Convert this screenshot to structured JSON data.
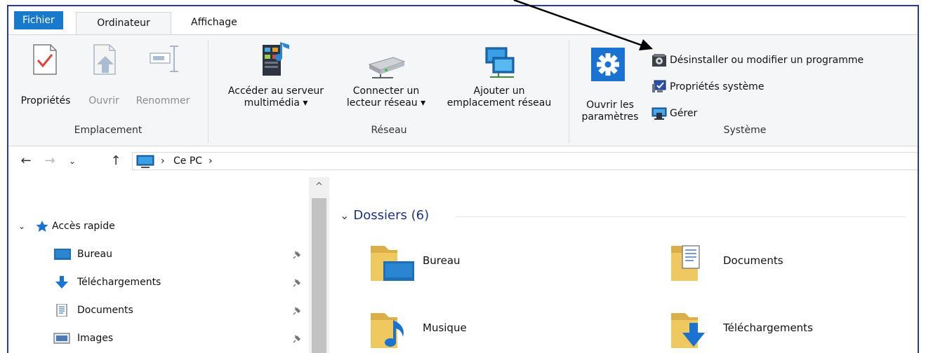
{
  "tabs": {
    "file": "Fichier",
    "computer": "Ordinateur",
    "view": "Affichage"
  },
  "ribbon": {
    "location": {
      "label": "Emplacement",
      "properties": "Propriétés",
      "open": "Ouvrir",
      "rename": "Renommer"
    },
    "network": {
      "label": "Réseau",
      "media_server_line1": "Accéder au serveur",
      "media_server_line2": "multimédia ▾",
      "map_drive_line1": "Connecter un",
      "map_drive_line2": "lecteur réseau ▾",
      "add_location_line1": "Ajouter un",
      "add_location_line2": "emplacement réseau"
    },
    "system": {
      "label": "Système",
      "open_settings_line1": "Ouvrir les",
      "open_settings_line2": "paramètres",
      "uninstall": "Désinstaller ou modifier un programme",
      "system_properties": "Propriétés système",
      "manage": "Gérer"
    }
  },
  "address": {
    "crumb_pc": "Ce PC",
    "sep1": "›",
    "sep2": "›"
  },
  "nav": {
    "quick_access": "Accès rapide",
    "items": [
      {
        "label": "Bureau"
      },
      {
        "label": "Téléchargements"
      },
      {
        "label": "Documents"
      },
      {
        "label": "Images"
      }
    ]
  },
  "content": {
    "group_title": "Dossiers (6)",
    "folders": [
      {
        "name": "Bureau"
      },
      {
        "name": "Documents"
      },
      {
        "name": "Musique"
      },
      {
        "name": "Téléchargements"
      }
    ]
  },
  "colors": {
    "accent": "#1979ca",
    "group_title": "#1e3287",
    "ribbon_bg": "#f5f6f7",
    "folder": "#e8c05c"
  }
}
